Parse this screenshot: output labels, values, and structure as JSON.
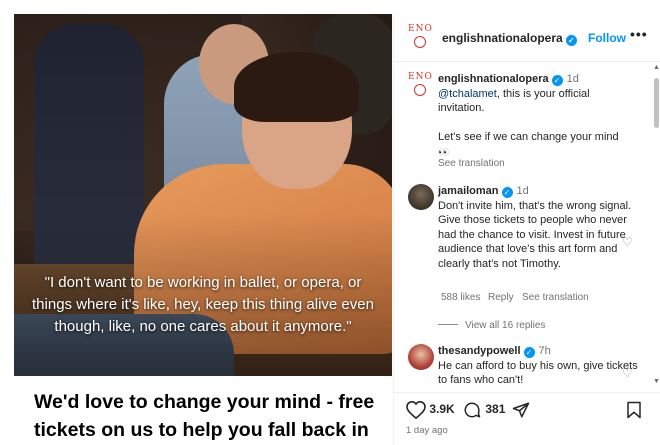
{
  "post": {
    "caption_quote": "\"I don't want to be working in ballet, or opera, or things where it's like, hey, keep this thing alive even though, like, no one cares about it anymore.\"",
    "headline": "We'd love to change your mind - free tickets on us to help you fall back in"
  },
  "header": {
    "logo_text": "ENO",
    "username": "englishnationalopera",
    "follow_label": "Follow",
    "more_label": "•••"
  },
  "caption_comment": {
    "username": "englishnationalopera",
    "time": "1d",
    "mention": "@tchalamet",
    "text_part1": ", this is your official invitation.",
    "text_part2": "Let's see if we can change your mind",
    "emoji": "👀",
    "see_translation": "See translation"
  },
  "comments": [
    {
      "username": "jamailoman",
      "time": "1d",
      "text": "Don't invite him, that's the wrong signal. Give those tickets to people who never had the chance to visit. Invest in future audience that love's this art form and clearly that's not Timothy.",
      "likes": "588 likes",
      "reply": "Reply",
      "see_translation": "See translation",
      "view_replies": "View all 16 replies"
    },
    {
      "username": "thesandypowell",
      "time": "7h",
      "text": "He can afford to buy his own, give tickets to fans who can't!"
    }
  ],
  "actions": {
    "likes_count": "3.9K",
    "comments_count": "381",
    "date": "1 day ago"
  },
  "colors": {
    "accent": "#0095f6",
    "brand": "#d4372f"
  }
}
